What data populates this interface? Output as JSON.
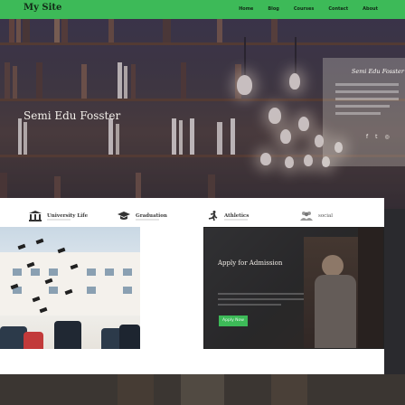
{
  "brand": "My Site",
  "nav": [
    "Home",
    "Blog",
    "Courses",
    "Contact",
    "About"
  ],
  "hero": {
    "title": "Semi Edu Fosster"
  },
  "profile": {
    "name": "Semi Edu Fosster",
    "social_icons": [
      "facebook-icon",
      "twitter-icon",
      "instagram-icon"
    ],
    "social_glyphs": [
      "f",
      "t",
      "◎"
    ]
  },
  "features": [
    {
      "label": "University Life",
      "icon": "university-icon"
    },
    {
      "label": "Graduation",
      "icon": "graduation-cap-icon"
    },
    {
      "label": "Athletics",
      "icon": "runner-icon"
    },
    {
      "label": "social",
      "icon": "users-icon"
    }
  ],
  "admission": {
    "title": "Apply for Admission",
    "button": "Apply Now"
  },
  "colors": {
    "accent": "#3dba58",
    "panel": "#ffffff",
    "nav_text": "#122a17"
  }
}
